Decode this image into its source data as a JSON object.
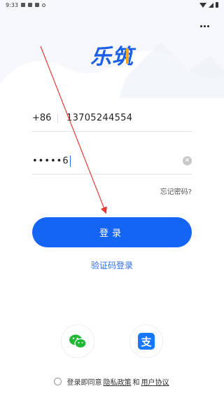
{
  "status_bar": {
    "time": "9:33"
  },
  "header": {
    "menu_icon": "more-horizontal-icon"
  },
  "logo": {
    "text": "乐筑"
  },
  "phone": {
    "country_code": "+86",
    "number": "13705244554"
  },
  "password": {
    "masked": "•••••6",
    "clear_icon": "clear-icon"
  },
  "forgot_password": "忘记密码?",
  "login_button": "登录",
  "sms_login": "验证码登录",
  "social": {
    "wechat_icon": "wechat-icon",
    "alipay_icon": "alipay-icon"
  },
  "agreement": {
    "prefix": "登录即同意",
    "privacy": "隐私政策",
    "and": "和",
    "terms": "用户协议"
  },
  "colors": {
    "primary": "#1565f5",
    "link": "#2f6fe6",
    "annotation": "#e53935"
  }
}
